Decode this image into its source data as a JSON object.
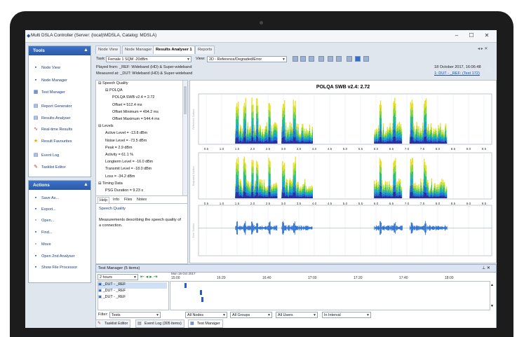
{
  "window": {
    "title": "Multi DSLA Controller (Server: (local)\\MDSLA, Catalog: MDSLA)",
    "minimize": "–",
    "maximize": "☐",
    "close": "✕"
  },
  "tools": {
    "header": "Tools",
    "items": [
      {
        "label": "Node View",
        "icon": "node-view-icon"
      },
      {
        "label": "Node Manager",
        "icon": "node-manager-icon"
      },
      {
        "label": "Test Manager",
        "icon": "test-manager-icon"
      },
      {
        "label": "Report Generator",
        "icon": "report-generator-icon"
      },
      {
        "label": "Results Analyser",
        "icon": "results-analyser-icon"
      },
      {
        "label": "Real-time Results",
        "icon": "realtime-results-icon"
      },
      {
        "label": "Result Favourites",
        "icon": "star-icon"
      },
      {
        "label": "Event Log",
        "icon": "event-log-icon"
      },
      {
        "label": "Tasklist Editor",
        "icon": "tasklist-editor-icon"
      }
    ]
  },
  "actions": {
    "header": "Actions",
    "items": [
      {
        "label": "Save As...",
        "icon": "save-icon"
      },
      {
        "label": "Export...",
        "icon": "export-icon"
      },
      {
        "label": "Open...",
        "icon": "open-icon"
      },
      {
        "label": "Find...",
        "icon": "find-icon"
      },
      {
        "label": "Move",
        "icon": "move-icon"
      },
      {
        "label": "Open 2nd Analyser",
        "icon": "analyser-icon"
      },
      {
        "label": "Show File Processor",
        "icon": "file-processor-icon"
      }
    ]
  },
  "tabs": [
    "Node View",
    "Node Manager",
    "Results Analyser 1",
    "Reports"
  ],
  "toolbar": {
    "task_label": "Task:",
    "task_value": "Female 1 SQM -20dBm",
    "view_label": "View:",
    "view_value": "2D - Reference/Degraded/Error"
  },
  "info": {
    "played_from": "Played from: _REF: Wideband (HD) & Super-wideband",
    "measured_at": "Measured at: _DUT: Wideband (HD) & Super-wideband",
    "date": "18 October 2017, 16:06:48",
    "link": "1: DUT - _REF: (Test 172)"
  },
  "tree": [
    {
      "label": "Speech Quality",
      "level": 0,
      "exp": "⊟"
    },
    {
      "label": "POLQA",
      "level": 1,
      "exp": "⊟"
    },
    {
      "label": "POLQA SWB v2.4 = 2.72",
      "level": 2
    },
    {
      "label": "Offset = 512.4 ms",
      "level": 2
    },
    {
      "label": "Offset Minimum = 494.2 ms",
      "level": 2
    },
    {
      "label": "Offset Maximum = 544.4 ms",
      "level": 2
    },
    {
      "label": "Levels",
      "level": 0,
      "exp": "⊟"
    },
    {
      "label": "Active Level = -13.8 dBm",
      "level": 1
    },
    {
      "label": "Noise Level = -73.5 dBm",
      "level": 1
    },
    {
      "label": "Peak = 2.9 dBm",
      "level": 1
    },
    {
      "label": "Activity = 61.1 %",
      "level": 1
    },
    {
      "label": "Longterm Level = -16.0 dBm",
      "level": 1
    },
    {
      "label": "Transmit Level = -18.0 dBm",
      "level": 1
    },
    {
      "label": "Loss = -34.2 dBm",
      "level": 1
    },
    {
      "label": "Timing Data",
      "level": 0,
      "exp": "⊟"
    },
    {
      "label": "PSG Duration = 9.23 s",
      "level": 1
    }
  ],
  "help": {
    "tabs": [
      "Help",
      "Info",
      "Files",
      "Notes"
    ],
    "title": "Speech Quality",
    "body": "Measurements describing the speech quality of a connection."
  },
  "chart_data": {
    "type": "area",
    "title": "POLQA SWB v2.4: 2.72",
    "panels": [
      "Reference Surface",
      "Degraded Surface",
      "Error Surface"
    ],
    "x_ticks": [
      "0.5",
      "1.0",
      "1.5",
      "2.0",
      "2.5",
      "3.0",
      "3.5",
      "4.0",
      "4.5",
      "5.0",
      "5.5",
      "6.0",
      "6.5",
      "7.0",
      "7.5",
      "8.0",
      "8.5",
      "9.0",
      "9.5"
    ],
    "xlim": [
      0.25,
      9.75
    ],
    "bursts": [
      {
        "start": 1.45,
        "end": 2.8
      },
      {
        "start": 2.95,
        "end": 3.95
      },
      {
        "start": 5.95,
        "end": 6.85
      },
      {
        "start": 7.1,
        "end": 8.3
      }
    ],
    "peaks": [
      1.5,
      1.75,
      2.0,
      2.15,
      2.55,
      3.0,
      3.35,
      6.15,
      6.6,
      7.15,
      7.6
    ]
  },
  "test_manager": {
    "title": "Test Manager (5 items)",
    "range_value": "2 hours",
    "date_label": "Mon 16 Oct 2017",
    "times": [
      "15:00",
      "16:20",
      "16:40",
      "17:00",
      "17:20",
      "17:40",
      "18:00"
    ],
    "rows": [
      "_DUT - _REF",
      "_DUT - _REF",
      "_DUT - _REF"
    ],
    "filter_label": "Filter:",
    "filters": [
      "Tests",
      "All Nodes",
      "All Groups",
      "All Users",
      "In Interval"
    ]
  },
  "bottom_tabs": [
    "Tasklist Editor",
    "Event Log (305 items)",
    "Test Manager"
  ],
  "colors": {
    "accent": "#2a58a8",
    "panel_bg": "#dfe6ee"
  }
}
